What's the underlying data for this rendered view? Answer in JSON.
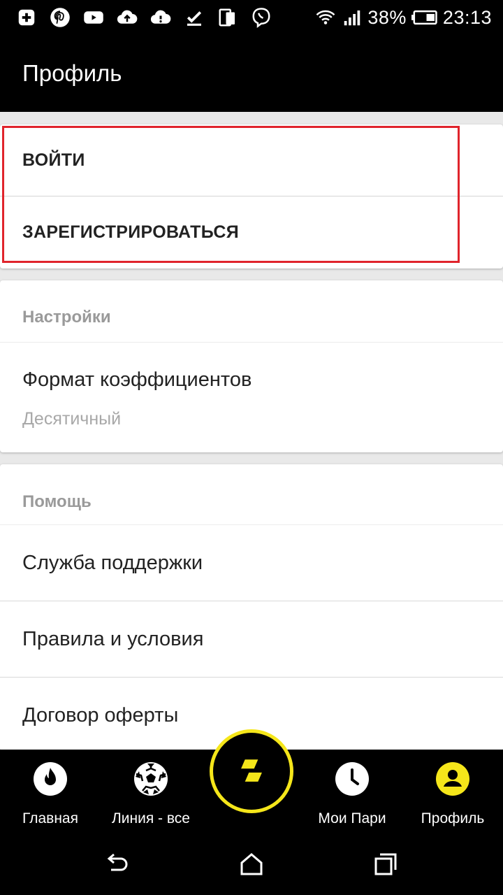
{
  "status_bar": {
    "battery_percent": "38%",
    "time": "23:13",
    "icons": [
      "add-app-icon",
      "pinterest-icon",
      "youtube-icon",
      "cloud-upload-icon",
      "cloud-alert-icon",
      "download-done-icon",
      "dual-screen-icon",
      "viber-icon",
      "wifi-icon",
      "signal-icon",
      "battery-icon"
    ]
  },
  "header": {
    "title": "Профиль"
  },
  "auth": {
    "login_label": "ВОЙТИ",
    "register_label": "ЗАРЕГИСТРИРОВАТЬСЯ",
    "highlight_color": "#e0242c"
  },
  "settings": {
    "title": "Настройки",
    "odds_format_label": "Формат коэффициентов",
    "odds_format_value": "Десятичный"
  },
  "help": {
    "title": "Помощь",
    "items": [
      {
        "label": "Служба поддержки"
      },
      {
        "label": "Правила и условия"
      },
      {
        "label": "Договор оферты"
      }
    ]
  },
  "bottom_nav": {
    "accent_color": "#f5e61a",
    "items": [
      {
        "label": "Главная",
        "icon": "flame-icon"
      },
      {
        "label": "Линия - все",
        "icon": "soccer-ball-icon"
      },
      {
        "label": "Мои Пари",
        "icon": "clock-icon"
      },
      {
        "label": "Профиль",
        "icon": "profile-icon",
        "active": true
      }
    ],
    "center_icon": "brand-logo-icon"
  }
}
